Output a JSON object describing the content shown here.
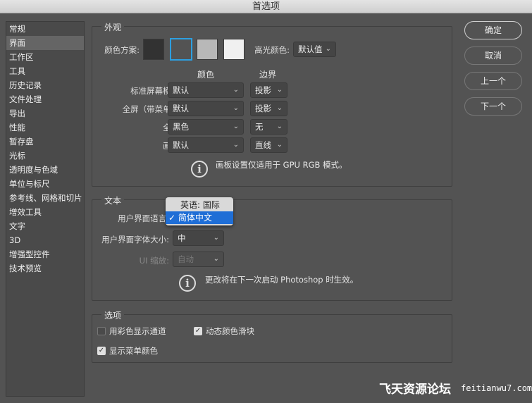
{
  "window": {
    "title": "首选项"
  },
  "sidebar": {
    "items": [
      "常规",
      "界面",
      "工作区",
      "工具",
      "历史记录",
      "文件处理",
      "导出",
      "性能",
      "暂存盘",
      "光标",
      "透明度与色域",
      "单位与标尺",
      "参考线、网格和切片",
      "增效工具",
      "文字",
      "3D",
      "增强型控件",
      "技术预览"
    ],
    "selected": 1
  },
  "appearance": {
    "title": "外观",
    "color_scheme_label": "颜色方案:",
    "highlight_label": "高光颜色:",
    "highlight_value": "默认值",
    "col_color": "颜色",
    "col_border": "边界",
    "rows": [
      {
        "label": "标准屏幕模式:",
        "color": "默认",
        "border": "投影"
      },
      {
        "label": "全屏（带菜单）:",
        "color": "默认",
        "border": "投影"
      },
      {
        "label": "全屏:",
        "color": "黑色",
        "border": "无"
      },
      {
        "label": "画板:",
        "color": "默认",
        "border": "直线"
      }
    ],
    "note": "画板设置仅适用于 GPU RGB 模式。",
    "swatch_colors": [
      "#323232",
      "#535353",
      "#b8b8b8",
      "#f0f0f0"
    ],
    "selected_swatch": 1,
    "accent": "#2d9fe0"
  },
  "text": {
    "title": "文本",
    "language_label": "用户界面语言:",
    "language_options": [
      "英语: 国际",
      "简体中文"
    ],
    "language_selected": "简体中文",
    "font_size_label": "用户界面字体大小:",
    "font_size_value": "中",
    "scale_label": "UI 缩放:",
    "scale_value": "自动",
    "note": "更改将在下一次启动 Photoshop 时生效。"
  },
  "options": {
    "title": "选项",
    "items": [
      {
        "label": "用彩色显示通道",
        "checked": false
      },
      {
        "label": "动态颜色滑块",
        "checked": true
      },
      {
        "label": "显示菜单颜色",
        "checked": true
      }
    ]
  },
  "buttons": {
    "ok": "确定",
    "cancel": "取消",
    "prev": "上一个",
    "next": "下一个"
  },
  "watermark": {
    "text": "飞天资源论坛",
    "url": "feitianwu7.com"
  }
}
